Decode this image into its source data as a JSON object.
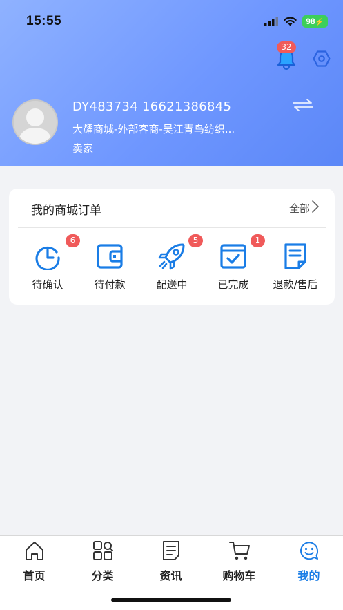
{
  "status": {
    "time": "15:55",
    "battery": "98"
  },
  "header": {
    "notification_count": "32",
    "user_id": "DY483734 16621386845",
    "company": "大耀商城-外部客商-吴江青鸟纺织...",
    "role": "卖家"
  },
  "orders": {
    "title": "我的商城订单",
    "view_all": "全部",
    "items": [
      {
        "label": "待确认",
        "badge": "6",
        "icon": "clock-icon"
      },
      {
        "label": "待付款",
        "badge": "",
        "icon": "wallet-icon"
      },
      {
        "label": "配送中",
        "badge": "5",
        "icon": "rocket-icon"
      },
      {
        "label": "已完成",
        "badge": "1",
        "icon": "calendar-check-icon"
      },
      {
        "label": "退款/售后",
        "badge": "",
        "icon": "document-icon"
      }
    ]
  },
  "tabbar": {
    "items": [
      {
        "label": "首页",
        "icon": "home-icon"
      },
      {
        "label": "分类",
        "icon": "category-icon"
      },
      {
        "label": "资讯",
        "icon": "news-icon"
      },
      {
        "label": "购物车",
        "icon": "cart-icon"
      },
      {
        "label": "我的",
        "icon": "smiley-icon",
        "active": true
      }
    ]
  },
  "colors": {
    "accent": "#1a7de6",
    "badge": "#f05a5a",
    "header_gradient_start": "#8fb2ff",
    "header_gradient_end": "#5b87f7"
  }
}
